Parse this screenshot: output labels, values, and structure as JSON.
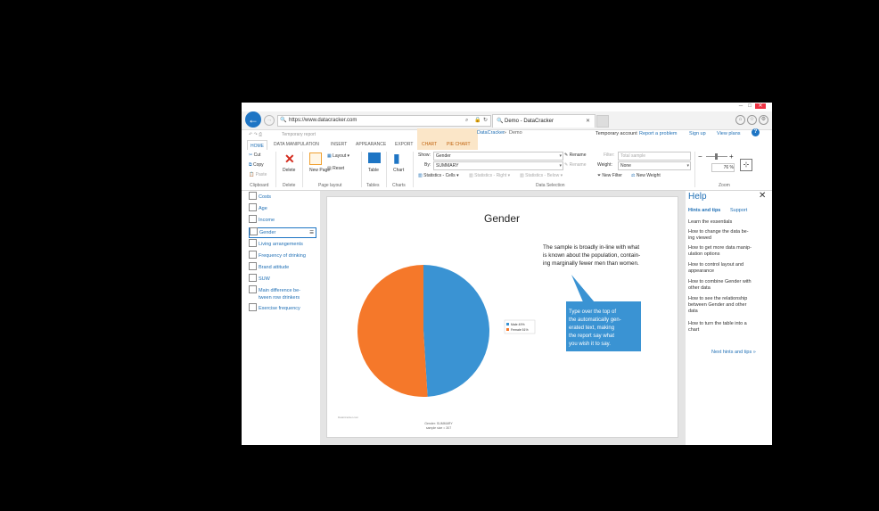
{
  "browser": {
    "url": "https://www.datacracker.com",
    "tab_title": "Demo - DataCracker"
  },
  "quick_access": {
    "label": "Temporary report"
  },
  "ribbon_tabs": [
    "HOME",
    "DATA MANIPULATION",
    "INSERT",
    "APPEARANCE",
    "EXPORT",
    "CHART",
    "PIE CHART"
  ],
  "breadcrumb": {
    "root": "DataCracker",
    "current": "Demo"
  },
  "account": {
    "temporary": "Temporary account",
    "report_problem": "Report a problem",
    "sign_up": "Sign up",
    "view_plans": "View plans"
  },
  "clipboard": {
    "cut": "Cut",
    "copy": "Copy",
    "paste": "Paste",
    "group": "Clipboard"
  },
  "delete_group": {
    "delete": "Delete",
    "group": "Delete"
  },
  "page_layout": {
    "new_page": "New Page",
    "layout": "Layout",
    "reset": "Reset",
    "group": "Page layout"
  },
  "tables": {
    "table": "Table",
    "group": "Tables"
  },
  "charts": {
    "chart": "Chart",
    "group": "Charts"
  },
  "data_selection": {
    "show_label": "Show:",
    "show_value": "Gender",
    "by_label": "By:",
    "by_value": "SUMMARY",
    "rename1": "Rename",
    "rename2": "Rename",
    "statistics_cells": "Statistics - Cells",
    "statistics_right": "Statistics - Right",
    "statistics_below": "Statistics - Below",
    "filter_label": "Filter:",
    "filter_value": "Total sample",
    "weight_label": "Weight:",
    "weight_value": "None",
    "new_filter": "New Filter",
    "new_weight": "New Weight",
    "group": "Data Selection"
  },
  "zoom": {
    "minus": "−",
    "plus": "+",
    "value": "76",
    "unit": "%",
    "group": "Zoom"
  },
  "sidebar": {
    "items": [
      {
        "label": "Costs",
        "icon": "table-icon"
      },
      {
        "label": "Age",
        "icon": "chart-icon"
      },
      {
        "label": "Income",
        "icon": "chart-icon"
      },
      {
        "label": "Gender",
        "icon": "chart-icon"
      },
      {
        "label": "Living arrangements",
        "icon": "table-icon"
      },
      {
        "label": "Frequency of drinking",
        "icon": "chart-icon"
      },
      {
        "label": "Brand attitude",
        "icon": "chart-icon"
      },
      {
        "label": "SUW",
        "icon": "chart-icon"
      },
      {
        "label": "Main difference be-",
        "label2": "tween row drinkers",
        "icon": "chart-icon"
      },
      {
        "label": "Exercise frequency",
        "icon": "table-icon"
      }
    ]
  },
  "report": {
    "title": "Gender",
    "commentary": [
      "The sample is broadly in-line with what",
      "is known about the population, contain-",
      "ing marginally fewer men than women."
    ],
    "callout": [
      "Type over the top of",
      "the automatically gen-",
      "erated text, making",
      "the report say what",
      "you wish it to say."
    ],
    "footer_left": "DataCracker.com",
    "footer_mid1": "Gender: SUMMARY",
    "footer_mid2": "sample size = 307"
  },
  "chart_data": {
    "type": "pie",
    "title": "Gender",
    "categories": [
      "Male",
      "Female"
    ],
    "values": [
      49,
      51
    ],
    "legend": [
      "Male 49%",
      "Female 51%"
    ],
    "colors": [
      "#3a93d3",
      "#f5782a"
    ],
    "legend_position": "right"
  },
  "help": {
    "title": "Help",
    "tab_hints": "Hints and tips",
    "tab_support": "Support",
    "items": [
      [
        "Learn the essentials"
      ],
      [
        "How to change the data be-",
        "ing viewed"
      ],
      [
        "How to get more data manip-",
        "ulation options"
      ],
      [
        "How to control layout and",
        "appearance"
      ],
      [
        "How to combine Gender with",
        "other data"
      ],
      [
        "How to see the relationship",
        "between Gender and other",
        "data"
      ],
      [
        "How to turn the table into a",
        "chart"
      ]
    ],
    "next_link": "Next hints and tips »"
  }
}
